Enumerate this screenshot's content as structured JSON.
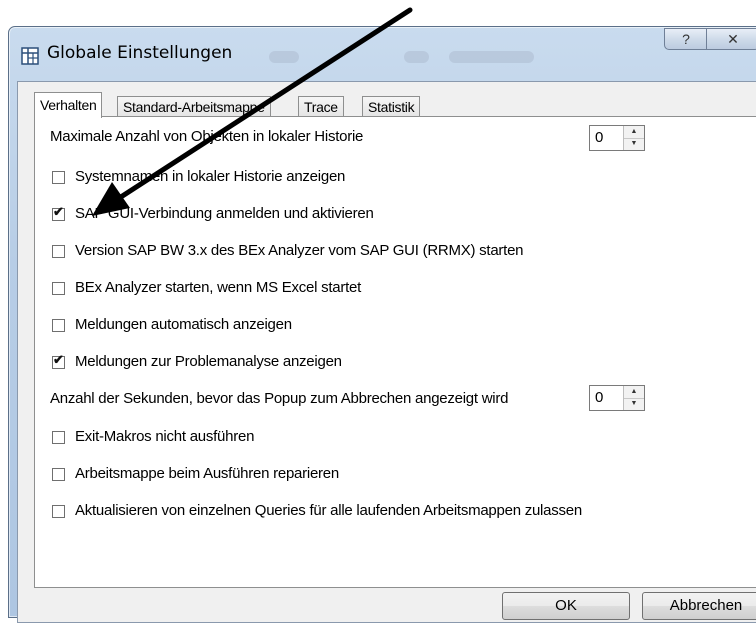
{
  "window": {
    "title": "Globale Einstellungen",
    "help_label": "?",
    "close_label": "✕"
  },
  "tabs": [
    {
      "label": "Verhalten",
      "active": true
    },
    {
      "label": "Standard-Arbeitsmappe",
      "active": false
    },
    {
      "label": "Trace",
      "active": false
    },
    {
      "label": "Statistik",
      "active": false
    }
  ],
  "settings": {
    "max_history_label": "Maximale Anzahl von Objekten in lokaler Historie",
    "max_history_value": "0",
    "seconds_label": "Anzahl der Sekunden, bevor das Popup zum Abbrechen angezeigt wird",
    "seconds_value": "0",
    "options": [
      {
        "label": "Systemnamen in lokaler Historie anzeigen",
        "checked": false
      },
      {
        "label": "SAP GUI-Verbindung anmelden und aktivieren",
        "checked": true
      },
      {
        "label": "Version SAP BW 3.x des BEx Analyzer vom SAP GUI (RRMX) starten",
        "checked": false
      },
      {
        "label": "BEx Analyzer starten, wenn MS Excel startet",
        "checked": false
      },
      {
        "label": "Meldungen automatisch anzeigen",
        "checked": false
      },
      {
        "label": "Meldungen zur Problemanalyse anzeigen",
        "checked": true
      },
      {
        "label": "Exit-Makros nicht ausführen",
        "checked": false
      },
      {
        "label": "Arbeitsmappe beim Ausführen reparieren",
        "checked": false
      },
      {
        "label": "Aktualisieren von einzelnen Queries für alle laufenden Arbeitsmappen zulassen",
        "checked": false
      }
    ]
  },
  "buttons": {
    "ok": "OK",
    "cancel": "Abbrechen"
  },
  "icons": {
    "window_icon": "grid-window-icon",
    "annotation": "arrow-pointer-icon"
  },
  "check_glyph": "✔"
}
